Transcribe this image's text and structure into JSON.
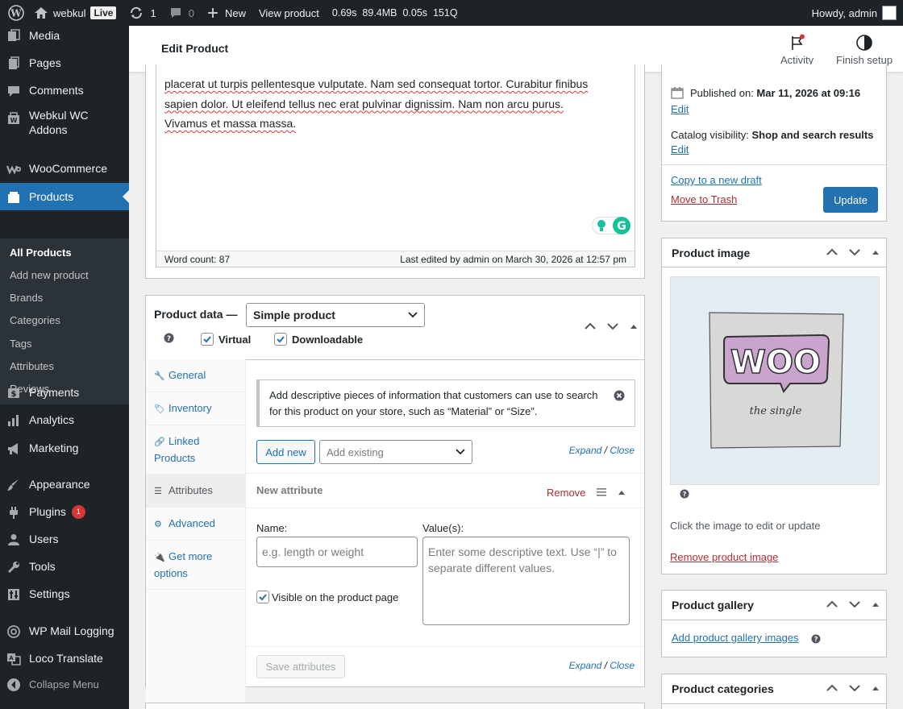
{
  "adminbar": {
    "site_name": "webkul",
    "live_badge": "Live",
    "updates_count": "1",
    "comments_count": "0",
    "new_label": "New",
    "view_product": "View product",
    "query_monitor": "0.69s  89.4MB  0.05s  151Q",
    "howdy": "Howdy, admin"
  },
  "menu": {
    "items": [
      {
        "label": "Media",
        "icon": "media-icon"
      },
      {
        "label": "Pages",
        "icon": "pages-icon"
      },
      {
        "label": "Comments",
        "icon": "comments-icon"
      },
      {
        "label": "Webkul WC\nAddons",
        "icon": "webkul-icon"
      },
      {
        "label": "WooCommerce",
        "icon": "woocommerce-icon"
      },
      {
        "label": "Products",
        "icon": "products-icon"
      },
      {
        "label": "Payments",
        "icon": "payments-icon"
      },
      {
        "label": "Analytics",
        "icon": "analytics-icon"
      },
      {
        "label": "Marketing",
        "icon": "marketing-icon"
      },
      {
        "label": "Appearance",
        "icon": "appearance-icon"
      },
      {
        "label": "Plugins",
        "icon": "plugins-icon",
        "badge": "1"
      },
      {
        "label": "Users",
        "icon": "users-icon"
      },
      {
        "label": "Tools",
        "icon": "tools-icon"
      },
      {
        "label": "Settings",
        "icon": "settings-icon"
      },
      {
        "label": "WP Mail Logging",
        "icon": "mail-icon"
      },
      {
        "label": "Loco Translate",
        "icon": "translate-icon"
      },
      {
        "label": "Collapse Menu",
        "icon": "collapse-icon"
      }
    ],
    "submenu": [
      "All Products",
      "Add new product",
      "Brands",
      "Categories",
      "Tags",
      "Attributes",
      "Reviews"
    ]
  },
  "header": {
    "title": "Edit Product",
    "activity": "Activity",
    "finish_setup": "Finish setup"
  },
  "editor": {
    "line1": "placerat ut turpis pellentesque vulputate. Nam sed consequat tortor. Curabitur finibus",
    "line2": "sapien dolor. Ut eleifend tellus nec erat pulvinar dignissim. Nam non arcu purus.",
    "line3": "Vivamus et massa massa.",
    "word_count": "Word count: 87",
    "last_edited": "Last edited by admin on March 30, 2026 at 12:57 pm"
  },
  "product_data": {
    "label": "Product data —",
    "type_value": "Simple product",
    "virtual_label": "Virtual",
    "downloadable_label": "Downloadable",
    "tabs": [
      {
        "label": "General",
        "icon": "wrench-icon"
      },
      {
        "label": "Inventory",
        "icon": "tag-icon"
      },
      {
        "label": "Linked Products",
        "icon": "link-icon"
      },
      {
        "label": "Attributes",
        "icon": "list-icon"
      },
      {
        "label": "Advanced",
        "icon": "gear-icon"
      },
      {
        "label": "Get more options",
        "icon": "plug-icon"
      }
    ],
    "notice": "Add descriptive pieces of information that customers can use to search for this product on your store, such as “Material” or “Size”.",
    "add_new": "Add new",
    "add_existing_placeholder": "Add existing",
    "expand": "Expand",
    "slash": " / ",
    "close": "Close",
    "new_attribute": "New attribute",
    "remove": "Remove",
    "name_label": "Name:",
    "name_placeholder": "e.g. length or weight",
    "values_label": "Value(s):",
    "values_placeholder": "Enter some descriptive text. Use “|” to separate different values.",
    "visible_label": "Visible on the product page",
    "save_attributes": "Save attributes"
  },
  "publish": {
    "published_on_label": "Published on:",
    "published_on_value": "Mar 11, 2026 at 09:16",
    "edit": "Edit",
    "catalog_label": "Catalog visibility:",
    "catalog_value": "Shop and search results",
    "copy_draft": "Copy to a new draft",
    "trash": "Move to Trash",
    "update": "Update"
  },
  "product_image": {
    "title": "Product image",
    "woo_text": "WOO",
    "woo_sub": "the single",
    "hint": "Click the image to edit or update",
    "remove": "Remove product image"
  },
  "gallery": {
    "title": "Product gallery",
    "add": "Add product gallery images"
  },
  "categories": {
    "title": "Product categories"
  },
  "colors": {
    "admin_dark": "#1d2327",
    "wp_blue": "#2271b1",
    "danger": "#b32d2e",
    "woo_purple": "#c9a4cd"
  }
}
